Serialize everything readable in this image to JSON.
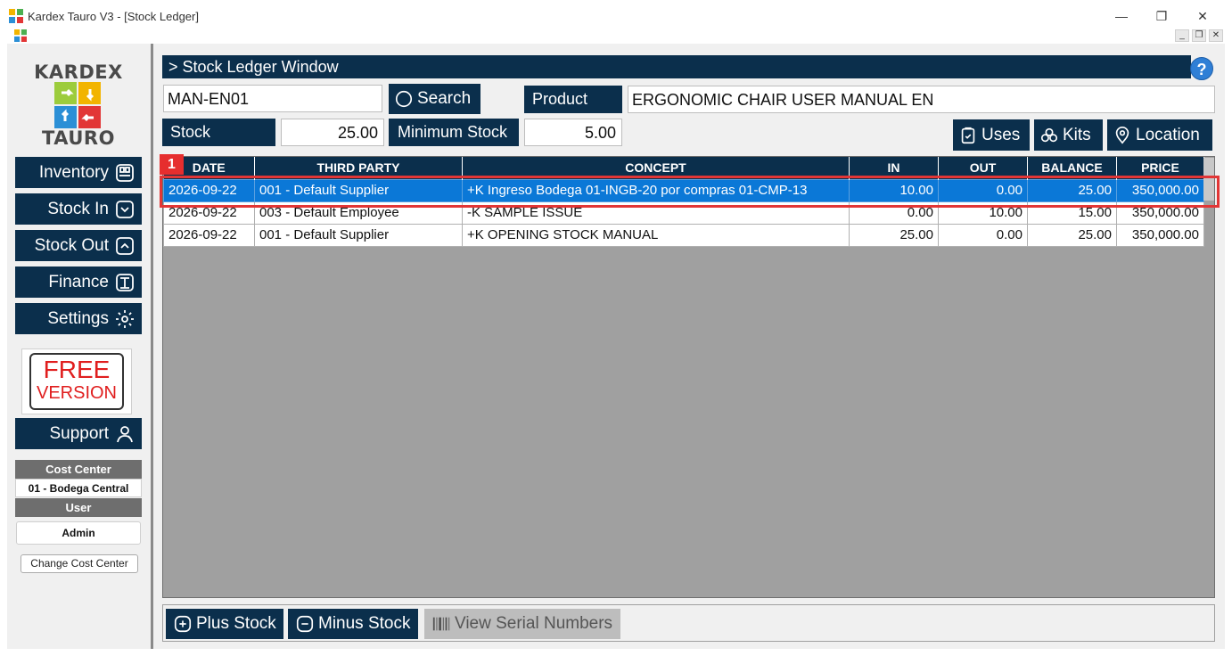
{
  "window": {
    "title": "Kardex Tauro V3 - [Stock Ledger]",
    "minimize": "—",
    "restore": "❐",
    "close": "✕",
    "mdi_min": "_",
    "mdi_restore": "❐",
    "mdi_close": "✕"
  },
  "sidebar": {
    "logo_top": "KARDEX",
    "logo_bottom": "TAURO",
    "nav": [
      {
        "label": "Inventory",
        "icon": "box-icon"
      },
      {
        "label": "Stock In",
        "icon": "tray-in-icon"
      },
      {
        "label": "Stock Out",
        "icon": "tray-out-icon"
      },
      {
        "label": "Finance",
        "icon": "book-icon"
      },
      {
        "label": "Settings",
        "icon": "gear-icon"
      }
    ],
    "free_line1": "FREE",
    "free_line2": "VERSION",
    "support": "Support",
    "cost_center_label": "Cost Center",
    "cost_center_value": "01 - Bodega Central",
    "user_label": "User",
    "user_value": "Admin",
    "change_cost_center": "Change Cost Center"
  },
  "main": {
    "header": "> Stock Ledger Window",
    "help": "?",
    "code_value": "MAN-EN01",
    "search_label": "Search",
    "product_label": "Product",
    "product_value": "ERGONOMIC CHAIR USER MANUAL EN",
    "stock_label": "Stock",
    "stock_value": "25.00",
    "min_stock_label": "Minimum Stock",
    "min_stock_value": "5.00",
    "uses_label": "Uses",
    "kits_label": "Kits",
    "location_label": "Location"
  },
  "table": {
    "marker": "1",
    "columns": [
      "DATE",
      "THIRD PARTY",
      "CONCEPT",
      "IN",
      "OUT",
      "BALANCE",
      "PRICE"
    ],
    "rows": [
      [
        "2026-09-22",
        "001 - Default Supplier",
        "+K Ingreso Bodega 01-INGB-20 por compras 01-CMP-13",
        "10.00",
        "0.00",
        "25.00",
        "350,000.00"
      ],
      [
        "2026-09-22",
        "003 - Default Employee",
        "-K SAMPLE ISSUE",
        "0.00",
        "10.00",
        "15.00",
        "350,000.00"
      ],
      [
        "2026-09-22",
        "001 - Default Supplier",
        "+K OPENING STOCK MANUAL",
        "25.00",
        "0.00",
        "25.00",
        "350,000.00"
      ]
    ],
    "selected_row": 0
  },
  "bottom": {
    "plus_stock": "Plus Stock",
    "minus_stock": "Minus Stock",
    "view_serial": "View Serial Numbers"
  },
  "colors": {
    "navy": "#0b2f4c",
    "selection": "#0b78d7",
    "highlight_red": "#e23636"
  }
}
